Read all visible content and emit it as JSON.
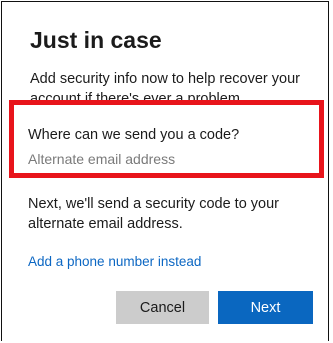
{
  "dialog": {
    "title": "Just in case",
    "intro": "Add security info now to help recover your account if there's ever a problem.",
    "question": "Where can we send you a code?",
    "email_placeholder": "Alternate email address",
    "email_value": "",
    "next_info": "Next, we'll send a security code to your alternate email address.",
    "phone_link": "Add a phone number instead",
    "cancel_label": "Cancel",
    "next_label": "Next"
  },
  "colors": {
    "highlight_border": "#e8141b",
    "primary_button": "#0a67c0",
    "secondary_button": "#cccccc",
    "link": "#0c67c3"
  }
}
